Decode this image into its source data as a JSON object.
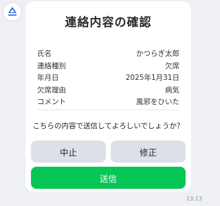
{
  "avatar": {
    "icon": "municipal-emblem-icon",
    "color": "#1e5fd6"
  },
  "dialog": {
    "title": "連絡内容の確認",
    "rows": [
      {
        "label": "氏名",
        "value": "かつらぎ太郎"
      },
      {
        "label": "連絡種別",
        "value": "欠席"
      },
      {
        "label": "年月日",
        "value": "2025年1月31日"
      },
      {
        "label": "欠席理由",
        "value": "病気"
      },
      {
        "label": "コメント",
        "value": "風邪をひいた"
      }
    ],
    "question": "こちらの内容で送信してよろしいでしょうか？",
    "cancel_label": "中止",
    "edit_label": "修正",
    "send_label": "送信"
  },
  "timestamp": "13:13",
  "colors": {
    "send": "#06c755",
    "secondary": "#dde0e8",
    "background": "#eef0f4"
  }
}
